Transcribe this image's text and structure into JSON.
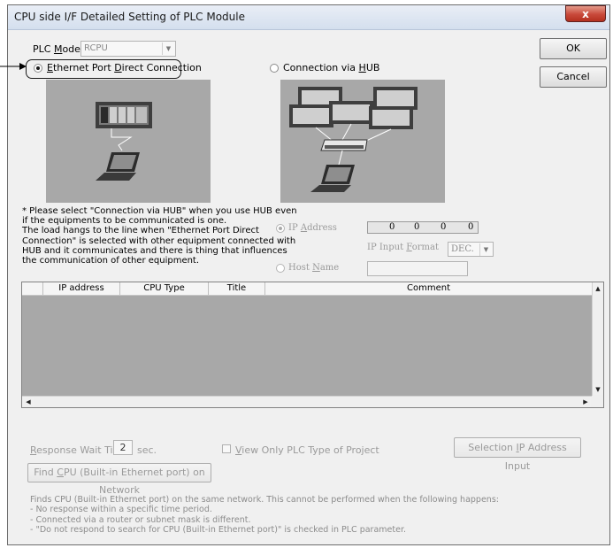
{
  "dialog": {
    "title": "CPU side I/F Detailed Setting of PLC Module",
    "close_glyph": "x"
  },
  "plc_mode": {
    "label_pre": "PLC ",
    "label_key": "M",
    "label_post": "ode",
    "value": "RCPU"
  },
  "buttons": {
    "ok": "OK",
    "cancel": "Cancel"
  },
  "connection": {
    "direct": {
      "pre": "",
      "key": "E",
      "post": "thernet Port ",
      "key2": "D",
      "post2": "irect Connection",
      "selected": true
    },
    "hub": {
      "pre": "Connection via ",
      "key": "H",
      "post": "UB",
      "selected": false
    }
  },
  "note_lines": [
    "* Please select \"Connection via HUB\" when you use HUB even",
    "if the equipments to be communicated is one.",
    "The load hangs to the line when \"Ethernet Port Direct",
    "Connection\" is selected with other equipment connected with",
    "HUB and it communicates and there is thing that influences",
    "the communication of other equipment."
  ],
  "ip": {
    "radio_pre": "IP ",
    "radio_key": "A",
    "radio_post": "ddress",
    "octets": [
      "0",
      "0",
      "0",
      "0"
    ],
    "format_pre": "IP Input ",
    "format_key": "F",
    "format_post": "ormat",
    "format_value": "DEC."
  },
  "host": {
    "pre": "Host ",
    "key": "N",
    "post": "ame",
    "value": ""
  },
  "table": {
    "columns": [
      "IP address",
      "CPU Type",
      "Title",
      "Comment"
    ],
    "rows": []
  },
  "response": {
    "key": "R",
    "post": "esponse Wait Time",
    "value": "2",
    "unit": "sec."
  },
  "view_only": {
    "key": "V",
    "post": "iew Only PLC Type of Project",
    "checked": false
  },
  "selection_ip": {
    "pre": "Selection ",
    "key": "I",
    "post": "P Address Input"
  },
  "find_cpu": {
    "pre": "Find ",
    "key": "C",
    "post": "PU (Built-in Ethernet port) on Network"
  },
  "info_lines": [
    "Finds CPU (Built-in Ethernet port) on the same network. This cannot be performed when the following happens:",
    "- No response within a specific time period.",
    "- Connected via a router or subnet mask is different.",
    "- \"Do not respond to search for CPU (Built-in Ethernet port)\" is checked in PLC parameter."
  ],
  "icons": {
    "close": "close-icon",
    "dropdown": "chevron-down-icon",
    "scroll_up": "scroll-up-arrow-icon",
    "scroll_down": "scroll-down-arrow-icon",
    "scroll_left": "scroll-left-arrow-icon",
    "scroll_right": "scroll-right-arrow-icon",
    "callout": "callout-arrow-icon",
    "direct_image": "plc-direct-connection-illustration",
    "hub_image": "plc-hub-connection-illustration"
  }
}
